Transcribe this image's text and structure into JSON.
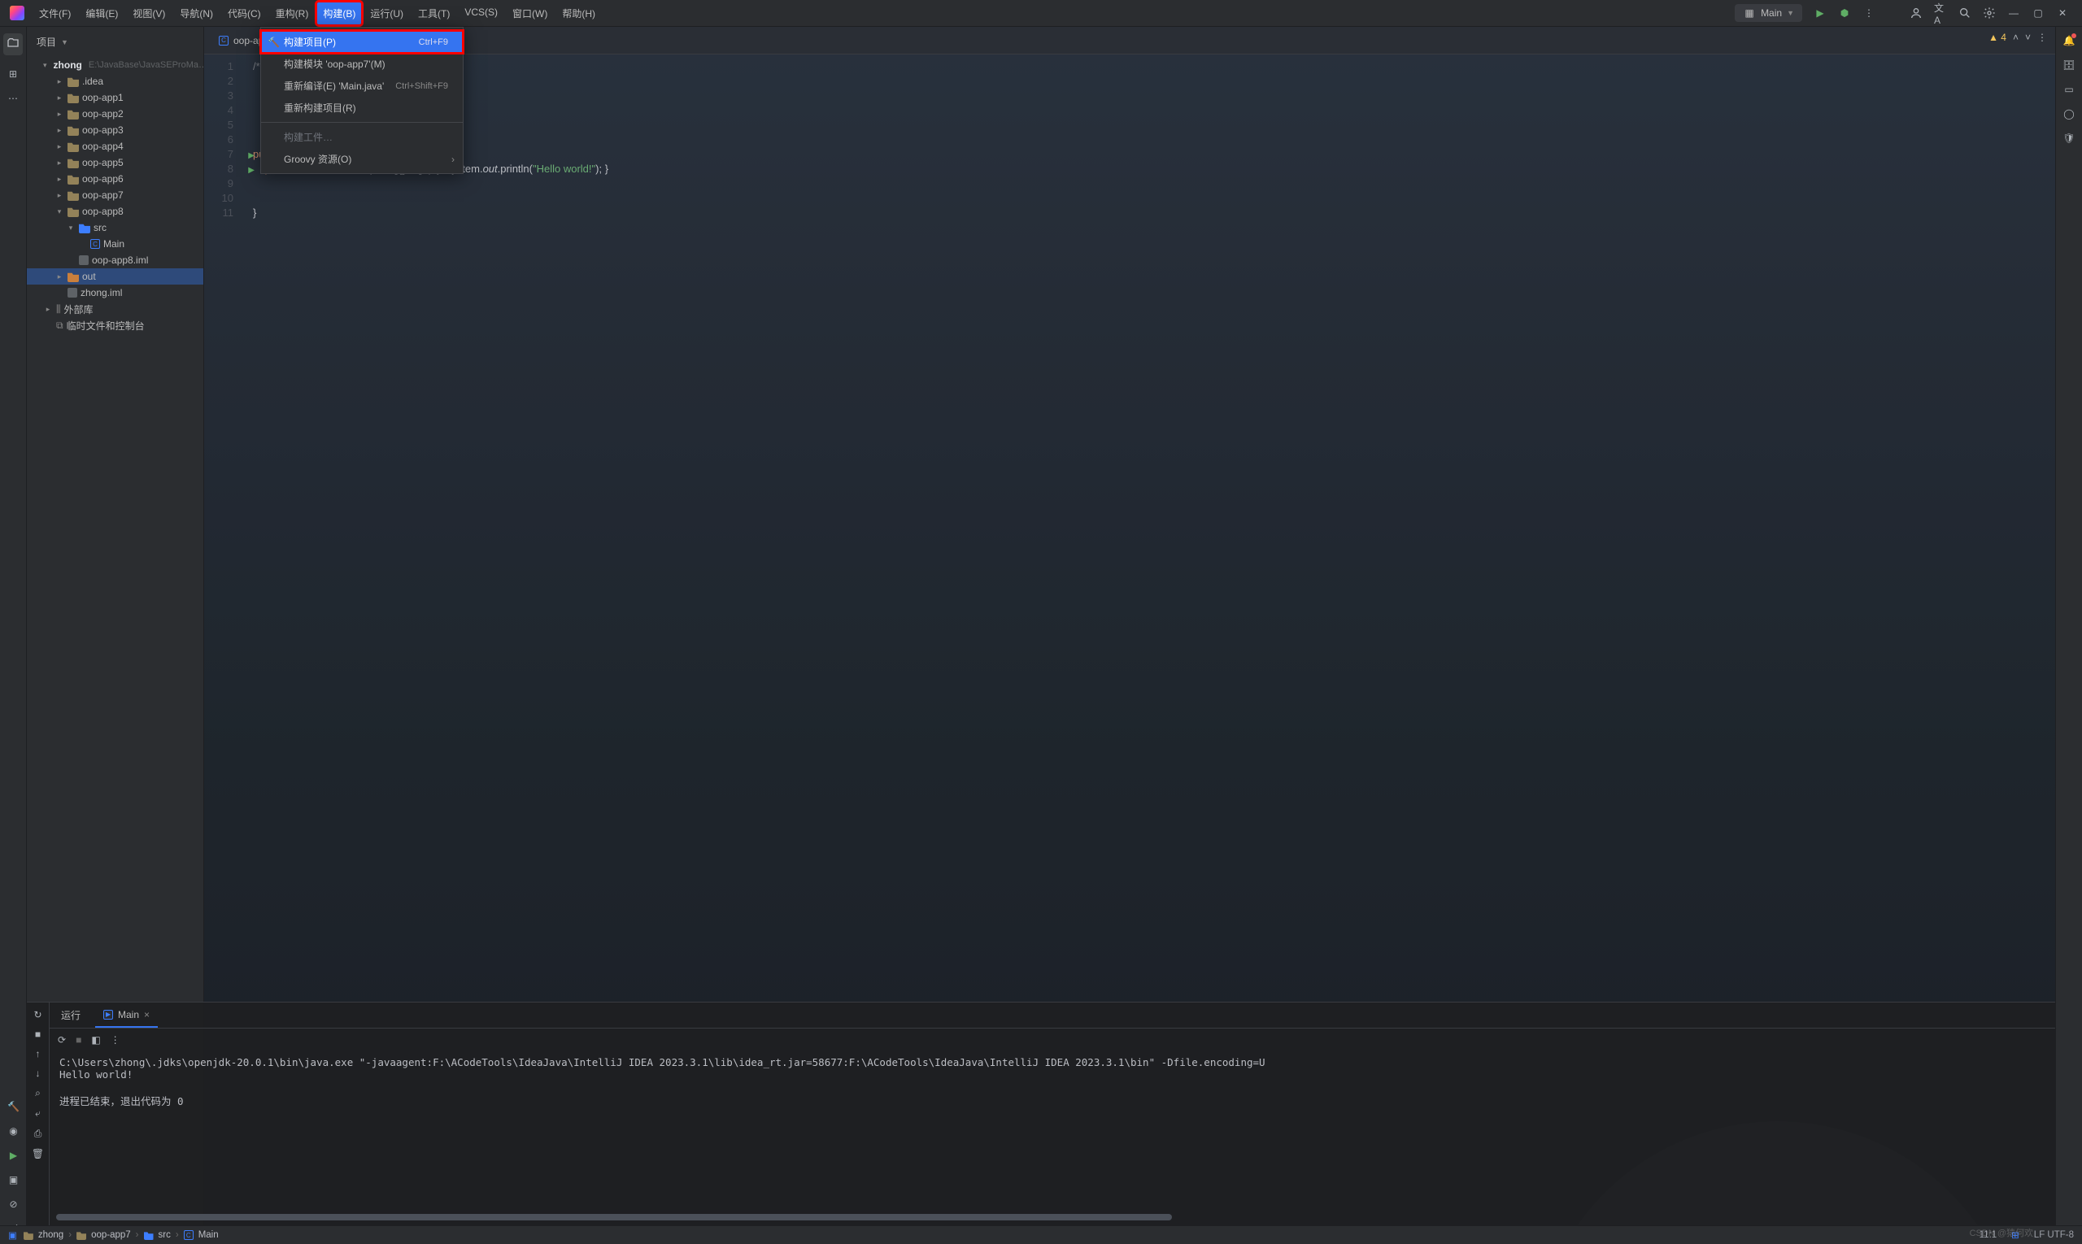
{
  "menubar": {
    "items": [
      "文件(F)",
      "编辑(E)",
      "视图(V)",
      "导航(N)",
      "代码(C)",
      "重构(R)",
      "构建(B)",
      "运行(U)",
      "工具(T)",
      "VCS(S)",
      "窗口(W)",
      "帮助(H)"
    ],
    "active_index": 6,
    "run_config": "Main"
  },
  "dropdown": {
    "items": [
      {
        "label": "构建项目(P)",
        "shortcut": "Ctrl+F9",
        "hammer": true,
        "highlight": true,
        "redbox": true
      },
      {
        "label": "构建模块 'oop-app7'(M)"
      },
      {
        "label": "重新编译(E) 'Main.java'",
        "shortcut": "Ctrl+Shift+F9"
      },
      {
        "label": "重新构建项目(R)"
      },
      {
        "sep": true
      },
      {
        "label": "构建工件…",
        "disabled": true
      },
      {
        "label": "Groovy 资源(O)",
        "submenu": true
      }
    ]
  },
  "project_panel": {
    "title": "项目",
    "root": {
      "name": "zhong",
      "path": "E:\\JavaBase\\JavaSEProMa…"
    },
    "tree": [
      {
        "d": 1,
        "chev": "▾",
        "icon": "fold",
        "label": "zhong",
        "extra": "E:\\JavaBase\\JavaSEProMa…"
      },
      {
        "d": 2,
        "chev": "▸",
        "icon": "fold",
        "label": ".idea"
      },
      {
        "d": 2,
        "chev": "▸",
        "icon": "fold",
        "label": "oop-app1"
      },
      {
        "d": 2,
        "chev": "▸",
        "icon": "fold",
        "label": "oop-app2"
      },
      {
        "d": 2,
        "chev": "▸",
        "icon": "fold",
        "label": "oop-app3"
      },
      {
        "d": 2,
        "chev": "▸",
        "icon": "fold",
        "label": "oop-app4"
      },
      {
        "d": 2,
        "chev": "▸",
        "icon": "fold",
        "label": "oop-app5"
      },
      {
        "d": 2,
        "chev": "▸",
        "icon": "fold",
        "label": "oop-app6"
      },
      {
        "d": 2,
        "chev": "▸",
        "icon": "fold",
        "label": "oop-app7"
      },
      {
        "d": 2,
        "chev": "▾",
        "icon": "fold",
        "label": "oop-app8"
      },
      {
        "d": 3,
        "chev": "▾",
        "icon": "foldb",
        "label": "src"
      },
      {
        "d": 4,
        "chev": "",
        "icon": "jfile",
        "label": "Main"
      },
      {
        "d": 3,
        "chev": "",
        "icon": "ifile",
        "label": "oop-app8.iml"
      },
      {
        "d": 2,
        "chev": "▸",
        "icon": "foldo",
        "label": "out",
        "sel": true
      },
      {
        "d": 2,
        "chev": "",
        "icon": "ifile",
        "label": "zhong.iml"
      },
      {
        "d": 1,
        "chev": "▸",
        "icon": "lib",
        "label": "外部库"
      },
      {
        "d": 1,
        "chev": "",
        "icon": "lib",
        "label": "临时文件和控制台"
      }
    ]
  },
  "editor": {
    "tab": "oop-ap",
    "warnings": "4",
    "lines": [
      {
        "n": 1,
        "html": "<span class='c-c'>/** …</span>"
      },
      {
        "n": 2,
        "html": ""
      },
      {
        "n": 3,
        "html": ""
      },
      {
        "n": 4,
        "html": ""
      },
      {
        "n": 5,
        "html": ""
      },
      {
        "n": 6,
        "html": ""
      },
      {
        "n": 7,
        "play": true,
        "html": "<span class='c-k'>public class</span> <span class='c-t'>Main</span> {"
      },
      {
        "n": 8,
        "play": true,
        "html": "&nbsp;&nbsp;&nbsp;&nbsp;<span class='c-k'>public static void</span> <span class='c-f'>main</span>(<span class='c-t'>String[] args</span>) { &nbsp;System.<span class='c-it'>out</span>.println(<span class='c-s'>\"Hello world!\"</span>); }"
      },
      {
        "n": 9,
        "html": ""
      },
      {
        "n": 10,
        "html": ""
      },
      {
        "n": 11,
        "html": "}"
      }
    ]
  },
  "run_panel": {
    "tab_run": "运行",
    "tab_main": "Main",
    "console_lines": [
      "C:\\Users\\zhong\\.jdks\\openjdk-20.0.1\\bin\\java.exe \"-javaagent:F:\\ACodeTools\\IdeaJava\\IntelliJ IDEA 2023.3.1\\lib\\idea_rt.jar=58677:F:\\ACodeTools\\IdeaJava\\IntelliJ IDEA 2023.3.1\\bin\" -Dfile.encoding=U",
      "Hello world!",
      "",
      "进程已结束，退出代码为 0"
    ]
  },
  "statusbar": {
    "crumbs": [
      "zhong",
      "oop-app7",
      "src",
      "Main"
    ],
    "pos": "11:1",
    "enc": "LF  UTF-8",
    "watermark": "CSDN @猿何欢"
  }
}
